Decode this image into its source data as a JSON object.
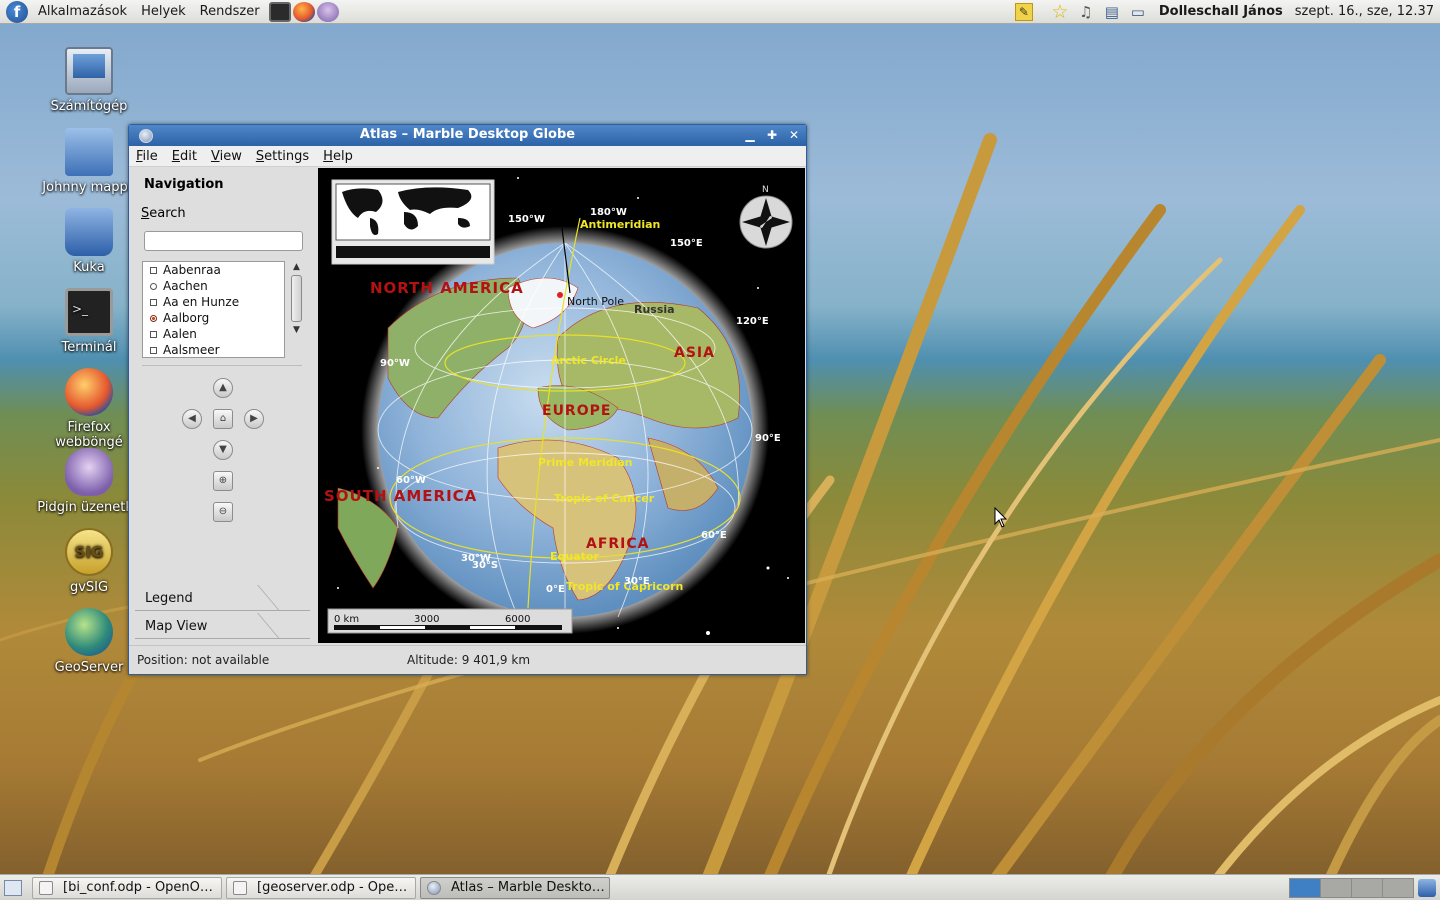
{
  "top_panel": {
    "menus": [
      "Alkalmazások",
      "Helyek",
      "Rendszer"
    ],
    "launchers": [
      "terminal-icon",
      "firefox-icon",
      "pidgin-icon"
    ],
    "tray_icons": [
      "notes-icon",
      "star-icon",
      "volume-icon",
      "network-icon",
      "monitor-icon"
    ],
    "user": "Dolleschall János",
    "clock": "szept. 16., sze, 12.37"
  },
  "desktop_icons": [
    {
      "label": "Számítógép",
      "icon": "computer-icon"
    },
    {
      "label": "Johnny mappá",
      "icon": "home-folder-icon"
    },
    {
      "label": "Kuka",
      "icon": "trash-icon"
    },
    {
      "label": "Terminál",
      "icon": "terminal-icon"
    },
    {
      "label": "Firefox webböngé",
      "icon": "firefox-icon"
    },
    {
      "label": "Pidgin üzenetkü",
      "icon": "pidgin-icon"
    },
    {
      "label": "gvSIG",
      "icon": "gvsig-icon",
      "logo_text": "SIG"
    },
    {
      "label": "GeoServer",
      "icon": "geoserver-icon"
    }
  ],
  "window": {
    "title": "Atlas – Marble Desktop Globe",
    "menu": [
      "File",
      "Edit",
      "View",
      "Settings",
      "Help"
    ],
    "navigation": {
      "title": "Navigation",
      "search_label": "Search",
      "search_value": "",
      "places": [
        {
          "name": "Aabenraa",
          "marker": "square"
        },
        {
          "name": "Aachen",
          "marker": "circle"
        },
        {
          "name": "Aa en Hunze",
          "marker": "square"
        },
        {
          "name": "Aalborg",
          "marker": "red-circle"
        },
        {
          "name": "Aalen",
          "marker": "square"
        },
        {
          "name": "Aalsmeer",
          "marker": "square"
        }
      ]
    },
    "tabs": [
      "Legend",
      "Map View"
    ],
    "map": {
      "continents": [
        "North America",
        "South America",
        "Europe",
        "Asia",
        "Africa"
      ],
      "places": [
        "North Pole",
        "Russia"
      ],
      "lines": [
        "Antimeridian",
        "Arctic Circle",
        "Prime Meridian",
        "Tropic of Cancer",
        "Equator",
        "Tropic of Capricorn"
      ],
      "grid_labels": [
        "150°W",
        "180°W",
        "150°E",
        "120°E",
        "90°W",
        "90°E",
        "60°W",
        "60°E",
        "30°W",
        "30°S",
        "0°E",
        "30°E"
      ],
      "compass_label": "N",
      "scale": [
        "0 km",
        "3000",
        "6000"
      ]
    },
    "status": {
      "position": "Position: not available",
      "altitude": "Altitude:  9 401,9 km"
    }
  },
  "taskbar": {
    "tasks": [
      {
        "label": "[bi_conf.odp - OpenO…",
        "active": false
      },
      {
        "label": "[geoserver.odp - Ope…",
        "active": false
      },
      {
        "label": "Atlas – Marble Deskto…",
        "active": true
      }
    ]
  }
}
